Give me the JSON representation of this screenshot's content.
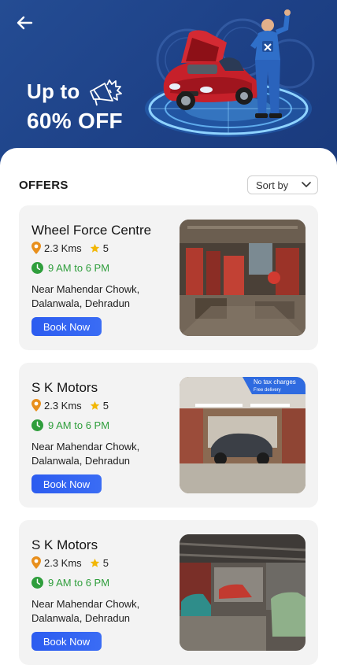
{
  "banner": {
    "promo_line1": "Up to",
    "promo_line2": "60% OFF"
  },
  "offers": {
    "title": "OFFERS",
    "sort_label": "Sort by"
  },
  "cards": [
    {
      "name": "Wheel Force Centre",
      "distance": "2.3 Kms",
      "rating": "5",
      "hours": "9 AM to 6 PM",
      "address_line1": "Near Mahendar Chowk,",
      "address_line2": "Dalanwala, Dehradun",
      "book_label": "Book Now"
    },
    {
      "name": "S K Motors",
      "distance": "2.3 Kms",
      "rating": "5",
      "hours": "9 AM to 6 PM",
      "address_line1": "Near Mahendar Chowk,",
      "address_line2": "Dalanwala, Dehradun",
      "book_label": "Book Now",
      "tag_line1": "No tax charges",
      "tag_line2": "Free delivery"
    },
    {
      "name": "S K Motors",
      "distance": "2.3 Kms",
      "rating": "5",
      "hours": "9 AM to 6 PM",
      "address_line1": "Near Mahendar Chowk,",
      "address_line2": "Dalanwala, Dehradun",
      "book_label": "Book Now"
    }
  ],
  "colors": {
    "banner": "#1e4288",
    "button": "#2c5cf0",
    "time_green": "#2f9e3c",
    "pin_orange": "#e88f1c",
    "star_yellow": "#f2b705",
    "card_bg": "#f3f3f3"
  },
  "icons": {
    "back": "arrow-left-icon",
    "megaphone": "megaphone-icon",
    "sort": "chevron-down-icon",
    "location": "location-pin-icon",
    "star": "star-icon",
    "clock": "clock-icon"
  }
}
